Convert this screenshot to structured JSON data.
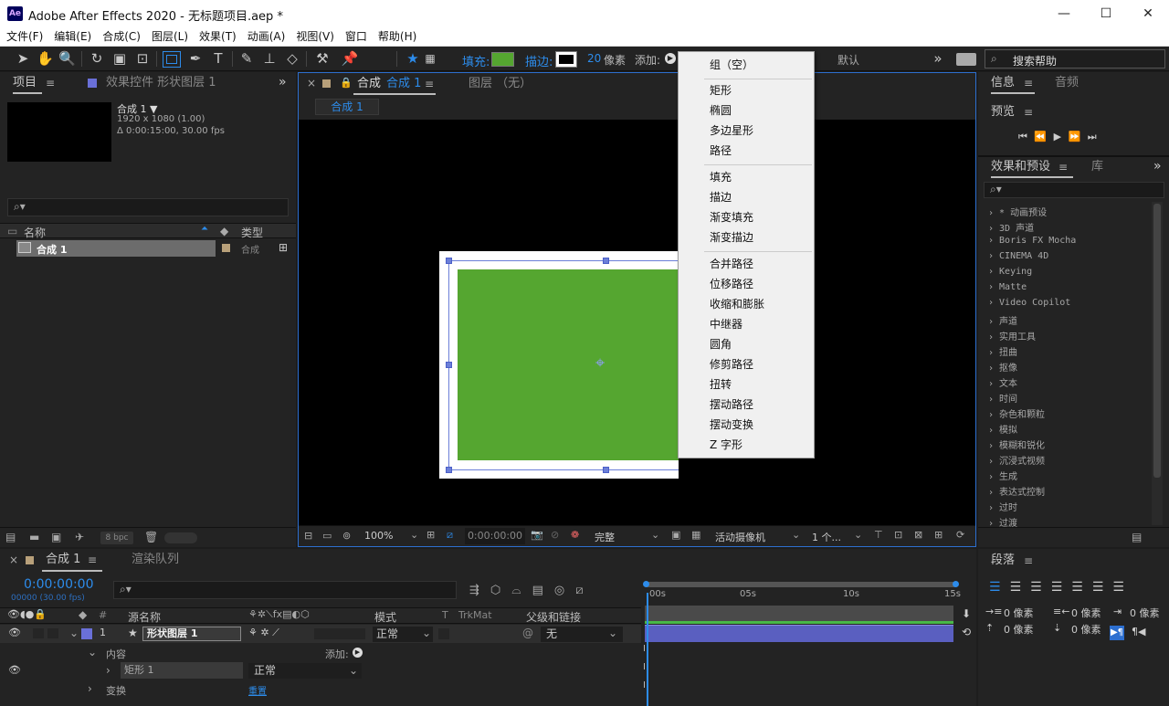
{
  "window": {
    "title": "Adobe After Effects 2020 - 无标题项目.aep *",
    "logo": "Ae",
    "min": "—",
    "max": "☐",
    "close": "✕"
  },
  "menu": [
    "文件(F)",
    "编辑(E)",
    "合成(C)",
    "图层(L)",
    "效果(T)",
    "动画(A)",
    "视图(V)",
    "窗口",
    "帮助(H)"
  ],
  "toolbar": {
    "fill_label": "填充:",
    "stroke_label": "描边:",
    "stroke_px": "20",
    "px_label": "像素",
    "add_label": "添加:",
    "default_label": "默认",
    "search_placeholder": "搜索帮助",
    "fill_color": "#55a630"
  },
  "project": {
    "tab": "项目",
    "effect_tab": "效果控件 形状图层 1",
    "comp_name": "合成 1 ▼",
    "comp_res": "1920 x 1080 (1.00)",
    "comp_duration": "Δ 0:00:15:00, 30.00 fps",
    "col_name": "名称",
    "col_type": "类型",
    "item_name": "合成 1",
    "item_type": "合成",
    "bpc": "8 bpc"
  },
  "comp_viewer": {
    "tab_label": "合成",
    "tab_comp": "合成 1",
    "layer_tab": "图层 （无）",
    "breadcrumb": "合成 1",
    "zoom": "100%",
    "timecode": "0:00:00:00",
    "quality": "完整",
    "camera": "活动摄像机",
    "views": "1 个..."
  },
  "add_menu": {
    "items_1": [
      "组（空）"
    ],
    "items_2": [
      "矩形",
      "椭圆",
      "多边星形",
      "路径"
    ],
    "items_3": [
      "填充",
      "描边",
      "渐变填充",
      "渐变描边"
    ],
    "items_4": [
      "合并路径",
      "位移路径",
      "收缩和膨胀",
      "中继器",
      "圆角",
      "修剪路径",
      "扭转",
      "摆动路径",
      "摆动变换",
      "Z 字形"
    ]
  },
  "right": {
    "info_tab": "信息",
    "audio_tab": "音频",
    "preview_tab": "预览",
    "effects_tab": "效果和预设",
    "library_tab": "库",
    "effects": [
      "* 动画预设",
      "3D 声道",
      "Boris FX Mocha",
      "CINEMA 4D",
      "Keying",
      "Matte",
      "Video Copilot",
      "声道",
      "实用工具",
      "扭曲",
      "抠像",
      "文本",
      "时间",
      "杂色和颗粒",
      "模拟",
      "模糊和锐化",
      "沉浸式视频",
      "生成",
      "表达式控制",
      "过时",
      "过渡"
    ],
    "paragraph_tab": "段落",
    "indent_values": [
      "0 像素",
      "0 像素",
      "0 像素",
      "0 像素",
      "0 像素"
    ]
  },
  "timeline": {
    "comp_tab": "合成 1",
    "render_tab": "渲染队列",
    "timecode": "0:00:00:00",
    "frames": "00000 (30.00 fps)",
    "col_source": "源名称",
    "col_mode": "模式",
    "col_t": "T",
    "col_trkmat": "TrkMat",
    "col_parent": "父级和链接",
    "layer_num": "1",
    "layer_name": "形状图层 1",
    "layer_mode": "正常",
    "layer_parent": "无",
    "contents_label": "内容",
    "add_label": "添加:",
    "rect_label": "矩形 1",
    "rect_mode": "正常",
    "transform_label": "变换",
    "reset_label": "重置",
    "ruler": [
      "00s",
      "05s",
      "10s",
      "15s"
    ]
  }
}
